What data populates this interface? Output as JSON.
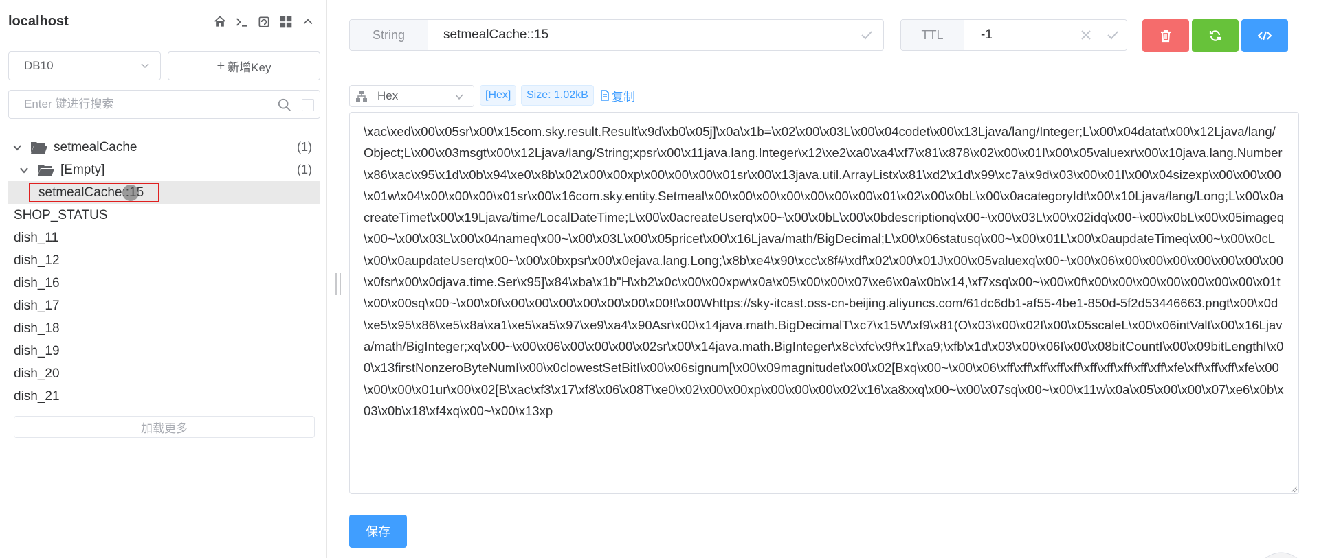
{
  "connection": {
    "title": "localhost"
  },
  "toolbar_icons": [
    "home-icon",
    "terminal-icon",
    "refresh-icon",
    "grid-icon",
    "chevron-up-icon"
  ],
  "db_select": {
    "selected": "DB10"
  },
  "add_key": {
    "label": "新增Key"
  },
  "search": {
    "placeholder": "Enter 键进行搜索"
  },
  "tree": {
    "folder": {
      "label": "setmealCache",
      "count": "(1)"
    },
    "subfolder": {
      "label": "[Empty]",
      "count": "(1)"
    },
    "selected_key": {
      "label": "setmealCache::15"
    }
  },
  "keys": [
    "SHOP_STATUS",
    "dish_11",
    "dish_12",
    "dish_16",
    "dish_17",
    "dish_18",
    "dish_19",
    "dish_20",
    "dish_21"
  ],
  "load_more": {
    "label": "加载更多"
  },
  "key_header": {
    "type": "String",
    "key_name": "setmealCache::15"
  },
  "ttl": {
    "label": "TTL",
    "value": "-1"
  },
  "view": {
    "format": "Hex",
    "format_tag": "[Hex]",
    "size_tag": "Size: 1.02kB",
    "copy_label": "复制"
  },
  "value": "\\xac\\xed\\x00\\x05sr\\x00\\x15com.sky.result.Result\\x9d\\xb0\\x05j]\\x0a\\x1b=\\x02\\x00\\x03L\\x00\\x04codet\\x00\\x13Ljava/lang/Integer;L\\x00\\x04datat\\x00\\x12Ljava/lang/Object;L\\x00\\x03msgt\\x00\\x12Ljava/lang/String;xpsr\\x00\\x11java.lang.Integer\\x12\\xe2\\xa0\\xa4\\xf7\\x81\\x878\\x02\\x00\\x01I\\x00\\x05valuexr\\x00\\x10java.lang.Number\\x86\\xac\\x95\\x1d\\x0b\\x94\\xe0\\x8b\\x02\\x00\\x00xp\\x00\\x00\\x00\\x01sr\\x00\\x13java.util.ArrayListx\\x81\\xd2\\x1d\\x99\\xc7a\\x9d\\x03\\x00\\x01I\\x00\\x04sizexp\\x00\\x00\\x00\\x01w\\x04\\x00\\x00\\x00\\x01sr\\x00\\x16com.sky.entity.Setmeal\\x00\\x00\\x00\\x00\\x00\\x00\\x00\\x01\\x02\\x00\\x0bL\\x00\\x0acategoryIdt\\x00\\x10Ljava/lang/Long;L\\x00\\x0acreateTimet\\x00\\x19Ljava/time/LocalDateTime;L\\x00\\x0acreateUserq\\x00~\\x00\\x0bL\\x00\\x0bdescriptionq\\x00~\\x00\\x03L\\x00\\x02idq\\x00~\\x00\\x0bL\\x00\\x05imageq\\x00~\\x00\\x03L\\x00\\x04nameq\\x00~\\x00\\x03L\\x00\\x05pricet\\x00\\x16Ljava/math/BigDecimal;L\\x00\\x06statusq\\x00~\\x00\\x01L\\x00\\x0aupdateTimeq\\x00~\\x00\\x0cL\\x00\\x0aupdateUserq\\x00~\\x00\\x0bxpsr\\x00\\x0ejava.lang.Long;\\x8b\\xe4\\x90\\xcc\\x8f#\\xdf\\x02\\x00\\x01J\\x00\\x05valuexq\\x00~\\x00\\x06\\x00\\x00\\x00\\x00\\x00\\x00\\x00\\x0fsr\\x00\\x0djava.time.Ser\\x95]\\x84\\xba\\x1b\"H\\xb2\\x0c\\x00\\x00xpw\\x0a\\x05\\x00\\x00\\x07\\xe6\\x0a\\x0b\\x14,\\xf7xsq\\x00~\\x00\\x0f\\x00\\x00\\x00\\x00\\x00\\x00\\x00\\x01t\\x00\\x00sq\\x00~\\x00\\x0f\\x00\\x00\\x00\\x00\\x00\\x00\\x00!t\\x00Whttps://sky-itcast.oss-cn-beijing.aliyuncs.com/61dc6db1-af55-4be1-850d-5f2d53446663.pngt\\x00\\x0d\\xe5\\x95\\x86\\xe5\\x8a\\xa1\\xe5\\xa5\\x97\\xe9\\xa4\\x90Asr\\x00\\x14java.math.BigDecimalT\\xc7\\x15W\\xf9\\x81(O\\x03\\x00\\x02I\\x00\\x05scaleL\\x00\\x06intValt\\x00\\x16Ljava/math/BigInteger;xq\\x00~\\x00\\x06\\x00\\x00\\x00\\x02sr\\x00\\x14java.math.BigInteger\\x8c\\xfc\\x9f\\x1f\\xa9;\\xfb\\x1d\\x03\\x00\\x06I\\x00\\x08bitCountI\\x00\\x09bitLengthI\\x00\\x13firstNonzeroByteNumI\\x00\\x0clowestSetBitI\\x00\\x06signum[\\x00\\x09magnitudet\\x00\\x02[Bxq\\x00~\\x00\\x06\\xff\\xff\\xff\\xff\\xff\\xff\\xff\\xff\\xff\\xff\\xfe\\xff\\xff\\xff\\xfe\\x00\\x00\\x00\\x01ur\\x00\\x02[B\\xac\\xf3\\x17\\xf8\\x06\\x08T\\xe0\\x02\\x00\\x00xp\\x00\\x00\\x00\\x02\\x16\\xa8xxq\\x00~\\x00\\x07sq\\x00~\\x00\\x11w\\x0a\\x05\\x00\\x00\\x07\\xe6\\x0b\\x03\\x0b\\x18\\xf4xq\\x00~\\x00\\x13xp",
  "save": {
    "label": "保存"
  },
  "colors": {
    "primary": "#409eff",
    "danger": "#f56c6c",
    "success": "#67c23a",
    "selection_border": "#e02020"
  }
}
